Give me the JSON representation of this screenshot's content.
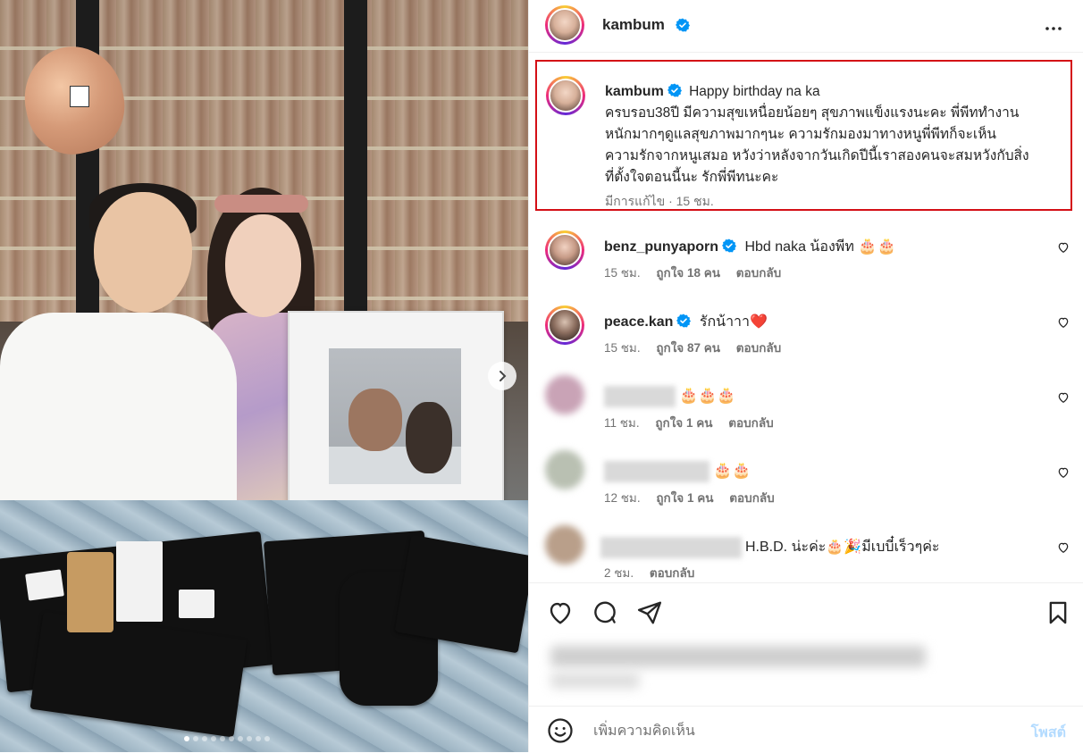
{
  "post": {
    "author": "kambum",
    "verified": true
  },
  "caption": {
    "username": "kambum",
    "lines": [
      "Happy birthday na ka",
      "ครบรอบ38ปี มีความสุขเหนื่อยน้อยๆ สุขภาพแข็งแรงนะคะ พี่พีททำงาน",
      "หนักมากๆดูแลสุขภาพมากๆนะ ความรักมองมาทางหนูพี่พีทก็จะเห็น",
      "ความรักจากหนูเสมอ หวังว่าหลังจากวันเกิดปีนี้เราสองคนจะสมหวังกับสิ่ง",
      "ที่ตั้งใจตอนนี้นะ รักพี่พีทนะคะ"
    ],
    "meta": "มีการแก้ไข · 15 ชม."
  },
  "comments": [
    {
      "username": "benz_punyaporn",
      "verified": true,
      "text": "Hbd naka น้องพีท",
      "emoji": "🎂🎂",
      "time": "15 ชม.",
      "likes": "ถูกใจ 18 คน",
      "reply": "ตอบกลับ"
    },
    {
      "username": "peace.kan",
      "verified": true,
      "text": "รักน้าาา",
      "emoji": "❤️",
      "time": "15 ชม.",
      "likes": "ถูกใจ 87 คน",
      "reply": "ตอบกลับ"
    },
    {
      "username": "",
      "verified": false,
      "text": "",
      "emoji": "🎂🎂🎂",
      "time": "11 ชม.",
      "likes": "ถูกใจ 1 คน",
      "reply": "ตอบกลับ"
    },
    {
      "username": "",
      "verified": false,
      "text": "",
      "emoji": "🎂🎂",
      "time": "12 ชม.",
      "likes": "ถูกใจ 1 คน",
      "reply": "ตอบกลับ"
    },
    {
      "username": "",
      "verified": false,
      "text": "H.B.D. น่ะค่ะ🎂🎉มีเบบี๋เร็วๆค่ะ",
      "emoji": "",
      "time": "2 ชม.",
      "likes": "",
      "reply": "ตอบกลับ"
    }
  ],
  "composer": {
    "placeholder": "เพิ่มความคิดเห็น",
    "post_label": "โพสต์"
  },
  "icons": {
    "like": "heart-icon",
    "comment": "comment-icon",
    "share": "share-icon",
    "save": "bookmark-icon",
    "emoji": "emoji-icon",
    "more": "more-icon",
    "next": "chevron-right-icon"
  },
  "colors": {
    "highlight_border": "#d40f16",
    "verified_blue": "#0095f6",
    "post_button": "#b3dbff",
    "meta_gray": "#737373"
  },
  "carousel": {
    "slides": 10,
    "current": 1
  }
}
